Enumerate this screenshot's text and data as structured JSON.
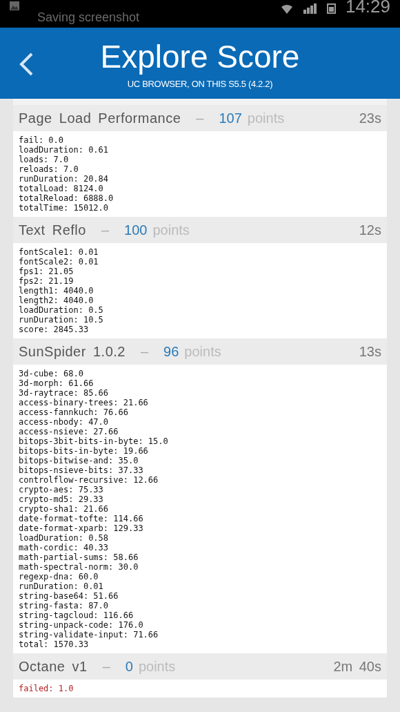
{
  "status_bar": {
    "notification": "Saving screenshot",
    "time": "14:29"
  },
  "header": {
    "title": "Explore Score",
    "subtitle": "UC BROWSER, ON THIS S5.5 (4.2.2)"
  },
  "sections": [
    {
      "title": "Page Load Performance",
      "separator": "–",
      "score": "107",
      "unit": "points",
      "time": "23s",
      "lines": [
        {
          "text": "fail: 0.0",
          "kind": "normal"
        },
        {
          "text": "loadDuration: 0.61",
          "kind": "normal"
        },
        {
          "text": "loads: 7.0",
          "kind": "normal"
        },
        {
          "text": "reloads: 7.0",
          "kind": "normal"
        },
        {
          "text": "runDuration: 20.84",
          "kind": "normal"
        },
        {
          "text": "totalLoad: 8124.0",
          "kind": "normal"
        },
        {
          "text": "totalReload: 6888.0",
          "kind": "normal"
        },
        {
          "text": "totalTime: 15012.0",
          "kind": "normal"
        }
      ]
    },
    {
      "title": "Text Reflo",
      "separator": "–",
      "score": "100",
      "unit": "points",
      "time": "12s",
      "lines": [
        {
          "text": "fontScale1: 0.01",
          "kind": "normal"
        },
        {
          "text": "fontScale2: 0.01",
          "kind": "normal"
        },
        {
          "text": "fps1: 21.05",
          "kind": "normal"
        },
        {
          "text": "fps2: 21.19",
          "kind": "normal"
        },
        {
          "text": "length1: 4040.0",
          "kind": "normal"
        },
        {
          "text": "length2: 4040.0",
          "kind": "normal"
        },
        {
          "text": "loadDuration: 0.5",
          "kind": "normal"
        },
        {
          "text": "runDuration: 10.5",
          "kind": "normal"
        },
        {
          "text": "score: 2845.33",
          "kind": "normal"
        }
      ]
    },
    {
      "title": "SunSpider 1.0.2",
      "separator": "–",
      "score": "96",
      "unit": "points",
      "time": "13s",
      "lines": [
        {
          "text": "3d-cube: 68.0",
          "kind": "normal"
        },
        {
          "text": "3d-morph: 61.66",
          "kind": "normal"
        },
        {
          "text": "3d-raytrace: 85.66",
          "kind": "normal"
        },
        {
          "text": "access-binary-trees: 21.66",
          "kind": "normal"
        },
        {
          "text": "access-fannkuch: 76.66",
          "kind": "normal"
        },
        {
          "text": "access-nbody: 47.0",
          "kind": "normal"
        },
        {
          "text": "access-nsieve: 27.66",
          "kind": "normal"
        },
        {
          "text": "bitops-3bit-bits-in-byte: 15.0",
          "kind": "normal"
        },
        {
          "text": "bitops-bits-in-byte: 19.66",
          "kind": "normal"
        },
        {
          "text": "bitops-bitwise-and: 35.0",
          "kind": "normal"
        },
        {
          "text": "bitops-nsieve-bits: 37.33",
          "kind": "normal"
        },
        {
          "text": "controlflow-recursive: 12.66",
          "kind": "normal"
        },
        {
          "text": "crypto-aes: 75.33",
          "kind": "normal"
        },
        {
          "text": "crypto-md5: 29.33",
          "kind": "normal"
        },
        {
          "text": "crypto-sha1: 21.66",
          "kind": "normal"
        },
        {
          "text": "date-format-tofte: 114.66",
          "kind": "normal"
        },
        {
          "text": "date-format-xparb: 129.33",
          "kind": "normal"
        },
        {
          "text": "loadDuration: 0.58",
          "kind": "normal"
        },
        {
          "text": "math-cordic: 40.33",
          "kind": "normal"
        },
        {
          "text": "math-partial-sums: 58.66",
          "kind": "normal"
        },
        {
          "text": "math-spectral-norm: 30.0",
          "kind": "normal"
        },
        {
          "text": "regexp-dna: 60.0",
          "kind": "normal"
        },
        {
          "text": "runDuration: 0.01",
          "kind": "normal"
        },
        {
          "text": "string-base64: 51.66",
          "kind": "normal"
        },
        {
          "text": "string-fasta: 87.0",
          "kind": "normal"
        },
        {
          "text": "string-tagcloud: 116.66",
          "kind": "normal"
        },
        {
          "text": "string-unpack-code: 176.0",
          "kind": "normal"
        },
        {
          "text": "string-validate-input: 71.66",
          "kind": "normal"
        },
        {
          "text": "total: 1570.33",
          "kind": "normal"
        }
      ]
    },
    {
      "title": "Octane v1",
      "separator": "–",
      "score": "0",
      "unit": "points",
      "time": "2m 40s",
      "lines": [
        {
          "text": "failed: 1.0",
          "kind": "error"
        }
      ]
    }
  ]
}
